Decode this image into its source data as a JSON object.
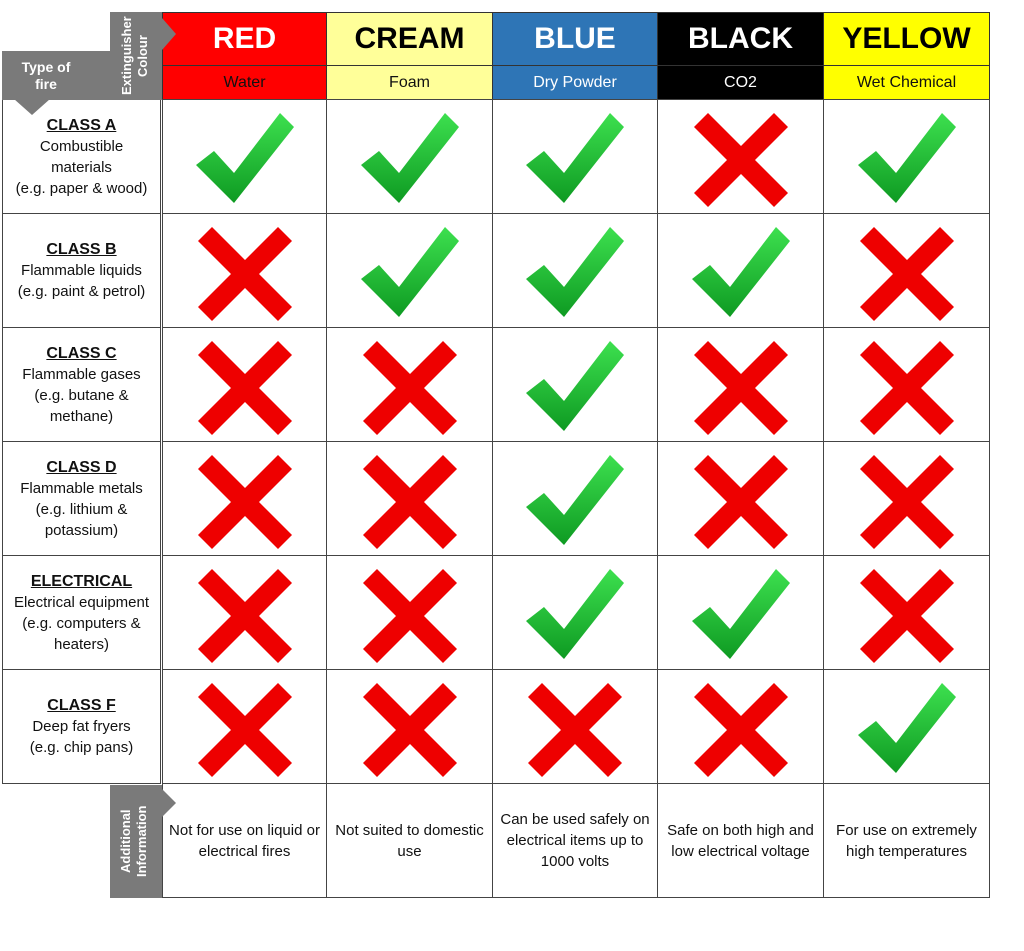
{
  "corner": {
    "type_of_fire": "Type of fire",
    "extinguisher_colour": "Extinguisher Colour",
    "additional_information": "Additional Information"
  },
  "extinguishers": [
    {
      "colour": "RED",
      "agent": "Water",
      "bg": "#ff0000",
      "fg": "#ffffff",
      "subfg": "#111111",
      "info": "Not for use on liquid or electrical fires"
    },
    {
      "colour": "CREAM",
      "agent": "Foam",
      "bg": "#ffff99",
      "fg": "#000000",
      "subfg": "#111111",
      "info": "Not suited to domestic use"
    },
    {
      "colour": "BLUE",
      "agent": "Dry Powder",
      "bg": "#2e75b6",
      "fg": "#ffffff",
      "subfg": "#ffffff",
      "info": "Can be used safely on electrical items up to 1000 volts"
    },
    {
      "colour": "BLACK",
      "agent": "CO2",
      "bg": "#000000",
      "fg": "#ffffff",
      "subfg": "#ffffff",
      "info": "Safe on both high and low electrical voltage"
    },
    {
      "colour": "YELLOW",
      "agent": "Wet Chemical",
      "bg": "#ffff00",
      "fg": "#000000",
      "subfg": "#111111",
      "info": "For use on extremely high temperatures"
    }
  ],
  "fire_classes": [
    {
      "title": "CLASS A",
      "lines": [
        "Combustible",
        "materials",
        "(e.g. paper & wood)"
      ],
      "suitable": [
        true,
        true,
        true,
        false,
        true
      ]
    },
    {
      "title": "CLASS B",
      "lines": [
        "Flammable liquids",
        "(e.g. paint & petrol)"
      ],
      "suitable": [
        false,
        true,
        true,
        true,
        false
      ]
    },
    {
      "title": "CLASS C",
      "lines": [
        "Flammable gases",
        "(e.g. butane &",
        "methane)"
      ],
      "suitable": [
        false,
        false,
        true,
        false,
        false
      ]
    },
    {
      "title": "CLASS D",
      "lines": [
        "Flammable metals",
        "(e.g. lithium &",
        "potassium)"
      ],
      "suitable": [
        false,
        false,
        true,
        false,
        false
      ]
    },
    {
      "title": "ELECTRICAL",
      "lines": [
        "Electrical equipment",
        "(e.g. computers &",
        "heaters)"
      ],
      "suitable": [
        false,
        false,
        true,
        true,
        false
      ]
    },
    {
      "title": "CLASS F",
      "lines": [
        "Deep fat fryers",
        "(e.g. chip pans)"
      ],
      "suitable": [
        false,
        false,
        false,
        false,
        true
      ]
    }
  ],
  "icons": {
    "suitable": "check-icon",
    "unsuitable": "cross-icon",
    "check_color": "#1fb534",
    "cross_color": "#ee0000"
  }
}
